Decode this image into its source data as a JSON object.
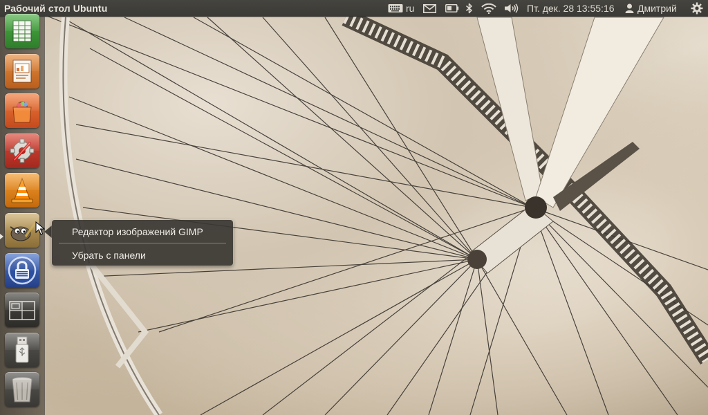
{
  "top_panel": {
    "window_title": "Рабочий стол Ubuntu",
    "keyboard_layout": "ru",
    "clock": "Пт. дек. 28 13:55:16",
    "user_name": "Дмитрий",
    "indicators": [
      "keyboard-icon",
      "mail-icon",
      "battery-icon",
      "bluetooth-icon",
      "wifi-icon",
      "volume-icon",
      "user-icon",
      "gear-icon"
    ]
  },
  "launcher": {
    "items": [
      {
        "name": "spreadsheet",
        "icon": "libreoffice-calc-icon",
        "color": "#3f9a3a"
      },
      {
        "name": "presentation",
        "icon": "libreoffice-impress-icon",
        "color": "#d2782e"
      },
      {
        "name": "software-center",
        "icon": "ubuntu-software-center-icon",
        "color": "#dd5a2a"
      },
      {
        "name": "system-settings",
        "icon": "system-settings-icon",
        "color": "#cc3b2f"
      },
      {
        "name": "vlc",
        "icon": "vlc-icon",
        "color": "#e88a1a"
      },
      {
        "name": "gimp",
        "icon": "gimp-icon",
        "color": "#a88d55",
        "running": true
      },
      {
        "name": "keepassx",
        "icon": "padlock-icon",
        "color": "#3a5fb0"
      },
      {
        "name": "workspace-switcher",
        "icon": "workspace-switcher-icon",
        "color": "#444444"
      },
      {
        "name": "usb-drive",
        "icon": "usb-icon",
        "color": "#555555"
      },
      {
        "name": "trash",
        "icon": "trash-icon",
        "color": "#555555"
      }
    ]
  },
  "quicklist": {
    "title": "Редактор изображений GIMP",
    "items": [
      "Убрать с панели"
    ]
  },
  "colors": {
    "panel": "#3c3b37",
    "quicklist_bg": "#3a3632",
    "wallpaper_tone": "#d5c8b4"
  }
}
